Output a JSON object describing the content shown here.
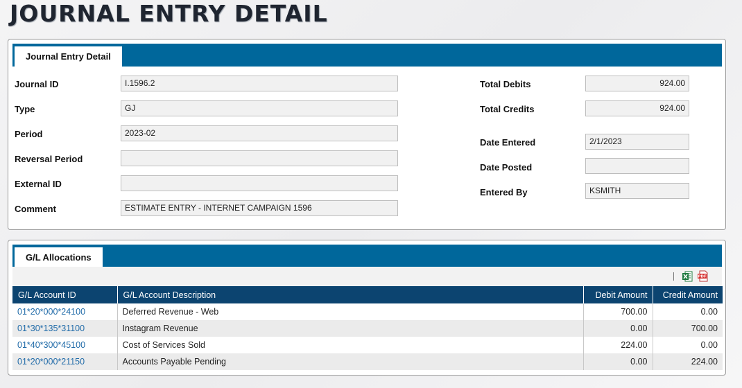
{
  "page_title": "JOURNAL ENTRY DETAIL",
  "detail_panel": {
    "tab_label": "Journal Entry Detail",
    "left_fields": [
      {
        "label": "Journal ID",
        "value": "I.1596.2"
      },
      {
        "label": "Type",
        "value": "GJ"
      },
      {
        "label": "Period",
        "value": "2023-02"
      },
      {
        "label": "Reversal Period",
        "value": ""
      },
      {
        "label": "External ID",
        "value": ""
      },
      {
        "label": "Comment",
        "value": "ESTIMATE ENTRY - INTERNET CAMPAIGN 1596"
      }
    ],
    "right_fields": [
      {
        "label": "Total Debits",
        "value": "924.00"
      },
      {
        "label": "Total Credits",
        "value": "924.00"
      },
      {
        "label": "Date Entered",
        "value": "2/1/2023"
      },
      {
        "label": "Date Posted",
        "value": ""
      },
      {
        "label": "Entered By",
        "value": "KSMITH"
      }
    ]
  },
  "alloc_panel": {
    "tab_label": "G/L Allocations",
    "toolbar_icons": [
      "excel-export-icon",
      "pdf-export-icon"
    ],
    "columns": [
      "G/L Account ID",
      "G/L Account Description",
      "Debit Amount",
      "Credit Amount"
    ],
    "rows": [
      {
        "account_id": "01*20*000*24100",
        "description": "Deferred Revenue - Web",
        "debit": "700.00",
        "credit": "0.00"
      },
      {
        "account_id": "01*30*135*31100",
        "description": "Instagram Revenue",
        "debit": "0.00",
        "credit": "700.00"
      },
      {
        "account_id": "01*40*300*45100",
        "description": "Cost of Services Sold",
        "debit": "224.00",
        "credit": "0.00"
      },
      {
        "account_id": "01*20*000*21150",
        "description": "Accounts Payable Pending",
        "debit": "0.00",
        "credit": "224.00"
      }
    ]
  },
  "colors": {
    "tab_bar": "#00679b",
    "table_header": "#0c4470",
    "link": "#1f6aa8",
    "alt_row": "#ebebeb",
    "field_bg": "#f1f1f1"
  }
}
